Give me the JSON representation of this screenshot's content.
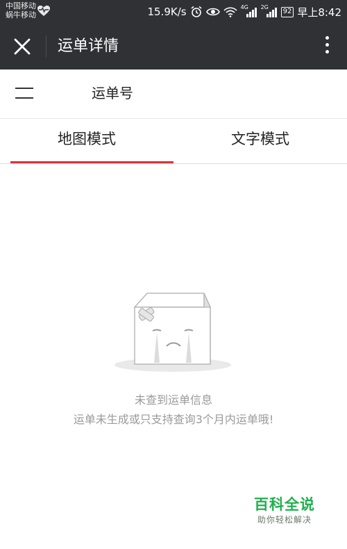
{
  "status_bar": {
    "carrier1": "中国移动",
    "carrier2": "蜗牛移动",
    "speed": "15.9K/s",
    "net_labels": [
      "4G",
      "2G"
    ],
    "battery": "92",
    "time": "早上8:42"
  },
  "app_bar": {
    "title": "运单详情",
    "close_icon": "close-icon",
    "more_icon": "more-vertical-icon"
  },
  "order": {
    "label": "运单号",
    "menu_icon": "menu-icon"
  },
  "tabs": [
    {
      "label": "地图模式",
      "active": true
    },
    {
      "label": "文字模式",
      "active": false
    }
  ],
  "empty_state": {
    "title": "未查到运单信息",
    "message": "运单未生成或只支持查询3个月内运单哦!"
  },
  "watermark": {
    "title": "百科全说",
    "subtitle": "助你轻松解决"
  },
  "colors": {
    "bar_bg": "#2f3135",
    "tab_indicator": "#d9343b",
    "empty_text": "#9a9a9a",
    "watermark_green": "#1fb04d"
  }
}
